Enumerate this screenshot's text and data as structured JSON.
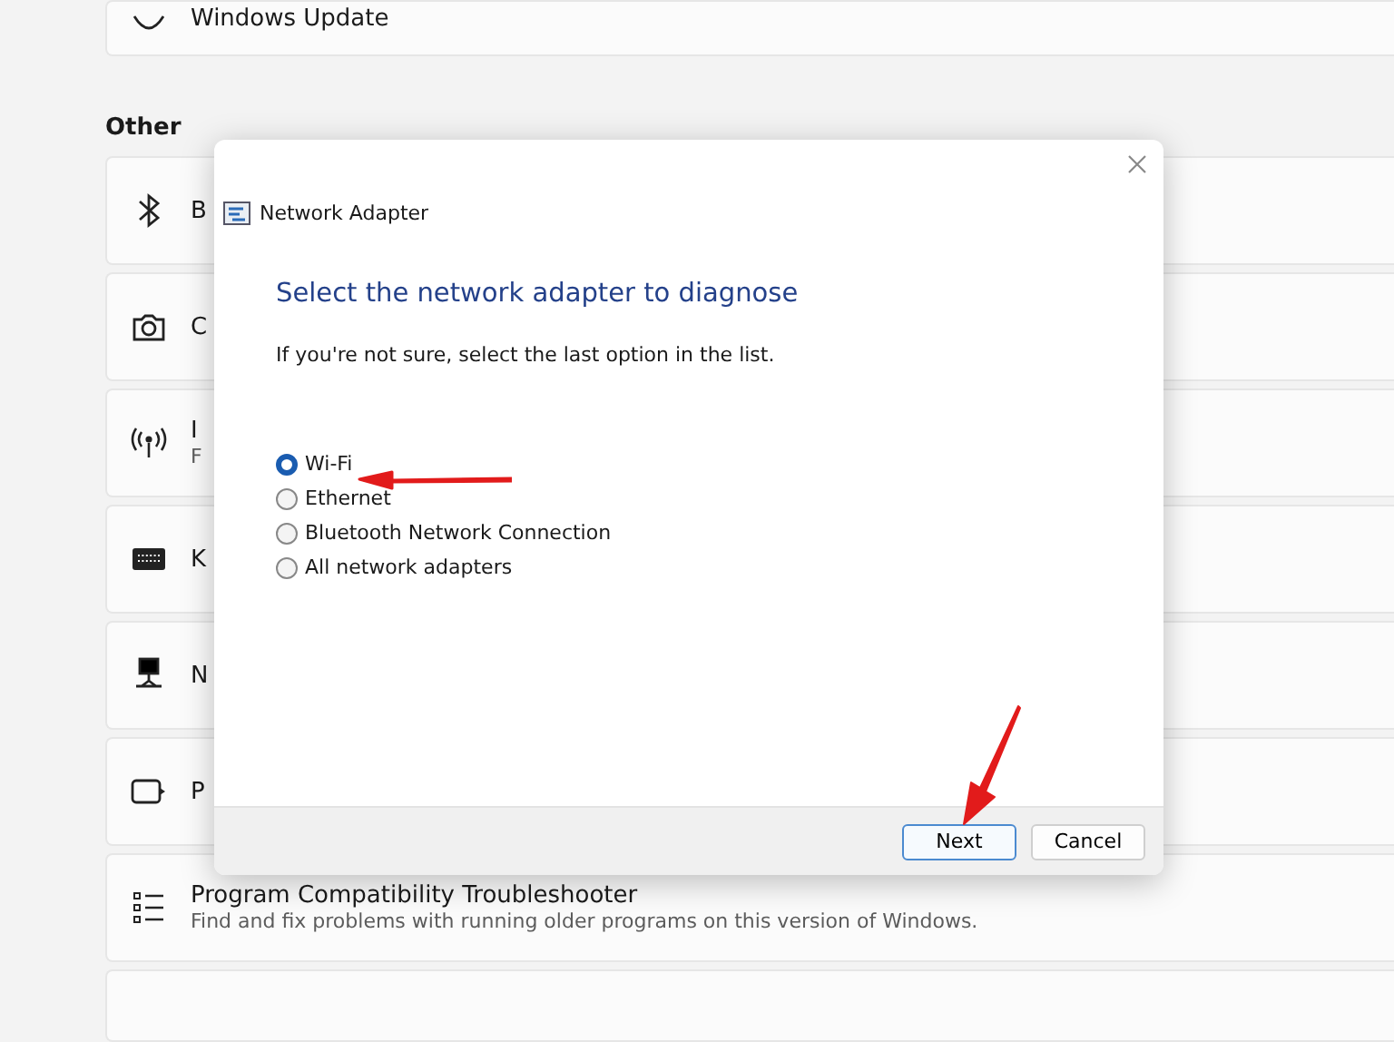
{
  "settings": {
    "top_item": {
      "label": "Windows Update"
    },
    "section_title": "Other",
    "items": [
      {
        "title": "B"
      },
      {
        "title": "C"
      },
      {
        "title": "I",
        "subtitle": "F"
      },
      {
        "title": "K"
      },
      {
        "title": "N"
      },
      {
        "title": "P"
      },
      {
        "title": "Program Compatibility Troubleshooter",
        "subtitle": "Find and fix problems with running older programs on this version of Windows."
      }
    ]
  },
  "dialog": {
    "title": "Network Adapter",
    "heading": "Select the network adapter to diagnose",
    "instruction": "If you're not sure, select the last option in the list.",
    "options": [
      {
        "label": "Wi-Fi",
        "selected": true
      },
      {
        "label": "Ethernet",
        "selected": false
      },
      {
        "label": "Bluetooth Network Connection",
        "selected": false
      },
      {
        "label": "All network adapters",
        "selected": false
      }
    ],
    "buttons": [
      {
        "label": "Next",
        "kind": "default"
      },
      {
        "label": "Cancel",
        "kind": "normal"
      }
    ]
  }
}
